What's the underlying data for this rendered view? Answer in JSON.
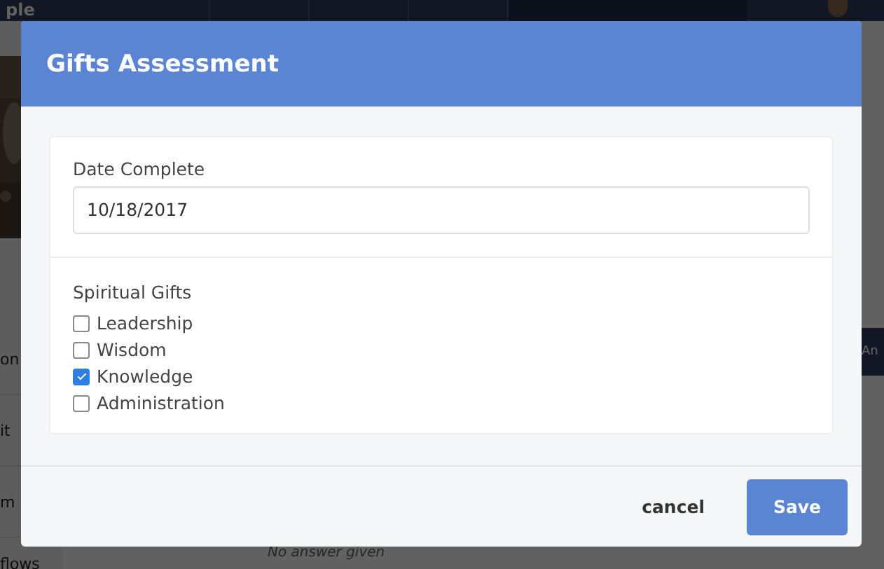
{
  "background": {
    "header_title": "ple",
    "nav_tabs": [
      {
        "selected": false
      },
      {
        "selected": false
      },
      {
        "selected": false
      },
      {
        "selected": true
      }
    ],
    "sidebar_items": [
      "on",
      "it",
      "m",
      "flows"
    ],
    "tab": "An",
    "answer": "No answer given"
  },
  "dialog": {
    "title": "Gifts Assessment",
    "date_field": {
      "label": "Date Complete",
      "value": "10/18/2017"
    },
    "gifts": {
      "label": "Spiritual Gifts",
      "options": [
        {
          "label": "Leadership",
          "checked": false
        },
        {
          "label": "Wisdom",
          "checked": false
        },
        {
          "label": "Knowledge",
          "checked": true
        },
        {
          "label": "Administration",
          "checked": false
        }
      ]
    },
    "buttons": [
      {
        "label": "cancel",
        "kind": "link"
      },
      {
        "label": "Save",
        "kind": "primary"
      }
    ]
  }
}
